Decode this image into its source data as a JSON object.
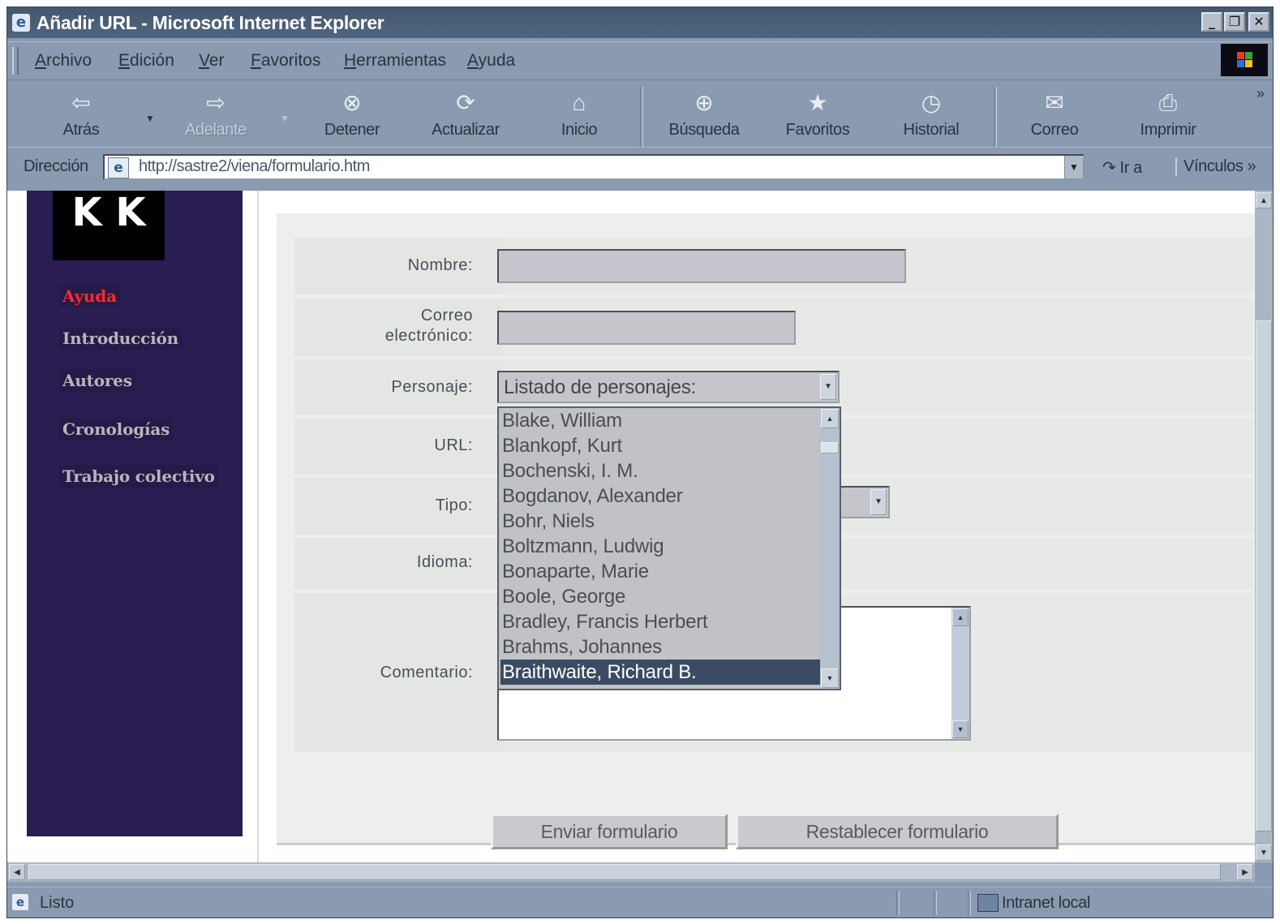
{
  "window": {
    "title": "Añadir URL - Microsoft Internet Explorer",
    "controls": [
      "_",
      "❐",
      "✕"
    ]
  },
  "menu": [
    "Archivo",
    "Edición",
    "Ver",
    "Favoritos",
    "Herramientas",
    "Ayuda"
  ],
  "toolbar": {
    "back": "Atrás",
    "forward": "Adelante",
    "stop": "Detener",
    "refresh": "Actualizar",
    "home": "Inicio",
    "search": "Búsqueda",
    "favorites": "Favoritos",
    "history": "Historial",
    "mail": "Correo",
    "print": "Imprimir",
    "more": "»"
  },
  "address": {
    "label": "Dirección",
    "url": "http://sastre2/viena/formulario.htm",
    "go": "Ir a",
    "links": "Vínculos »"
  },
  "sidebar": {
    "logo": "K K",
    "items": [
      {
        "label": "Ayuda",
        "active": true
      },
      {
        "label": "Introducción",
        "active": false
      },
      {
        "label": "Autores",
        "active": false
      },
      {
        "label": "Cronologías",
        "active": false
      },
      {
        "label": "Trabajo colectivo",
        "active": false
      }
    ]
  },
  "form": {
    "nombre_label": "Nombre:",
    "correo_label_1": "Correo",
    "correo_label_2": "electrónico:",
    "personaje_label": "Personaje:",
    "url_label": "URL:",
    "tipo_label": "Tipo:",
    "idioma_label": "Idioma:",
    "comentario_label": "Comentario:",
    "personaje_selected": "Listado de personajes:",
    "personaje_options": [
      "Blake, William",
      "Blankopf, Kurt",
      "Bochenski, I. M.",
      "Bogdanov, Alexander",
      "Bohr, Niels",
      "Boltzmann, Ludwig",
      "Bonaparte, Marie",
      "Boole, George",
      "Bradley, Francis Herbert",
      "Brahms, Johannes",
      "Braithwaite, Richard B."
    ],
    "highlighted_option": "Braithwaite, Richard B.",
    "submit": "Enviar formulario",
    "reset": "Restablecer formulario"
  },
  "status": {
    "text": "Listo",
    "zone": "Intranet local"
  },
  "colors": {
    "sidebar": "#2a1d52",
    "active_nav": "#ff2a2a",
    "chrome": "#8a9ab0",
    "selection": "#3b4b63"
  }
}
